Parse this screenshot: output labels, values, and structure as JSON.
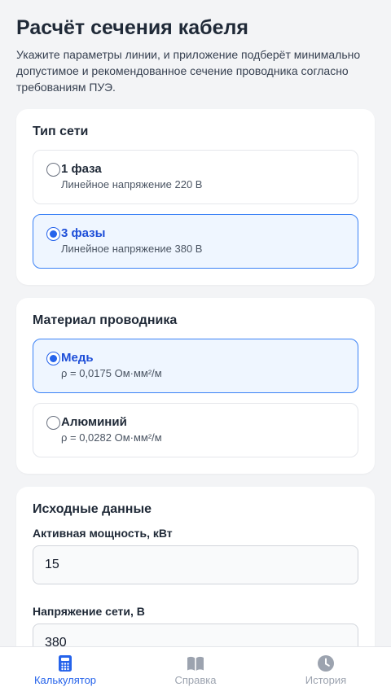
{
  "header": {
    "title": "Расчёт сечения кабеля",
    "subtitle": "Укажите параметры линии, и приложение подберёт минимально допустимое и рекомендованное сечение проводника согласно требованиям ПУЭ."
  },
  "network_type": {
    "title": "Тип сети",
    "options": [
      {
        "label": "1 фаза",
        "desc": "Линейное напряжение 220 В",
        "selected": false
      },
      {
        "label": "3 фазы",
        "desc": "Линейное напряжение 380 В",
        "selected": true
      }
    ]
  },
  "material": {
    "title": "Материал проводника",
    "options": [
      {
        "label": "Медь",
        "desc": "ρ = 0,0175 Ом·мм²/м",
        "selected": true
      },
      {
        "label": "Алюминий",
        "desc": "ρ = 0,0282 Ом·мм²/м",
        "selected": false
      }
    ]
  },
  "inputs": {
    "title": "Исходные данные",
    "power": {
      "label": "Активная мощность, кВт",
      "value": "15"
    },
    "voltage": {
      "label": "Напряжение сети, В",
      "value": "380"
    }
  },
  "tabs": [
    {
      "label": "Калькулятор",
      "icon": "calculator-icon",
      "active": true
    },
    {
      "label": "Справка",
      "icon": "book-icon",
      "active": false
    },
    {
      "label": "История",
      "icon": "clock-icon",
      "active": false
    }
  ],
  "colors": {
    "accent": "#2563eb",
    "selected_bg": "#eff6ff",
    "inactive": "#9ca3af"
  }
}
